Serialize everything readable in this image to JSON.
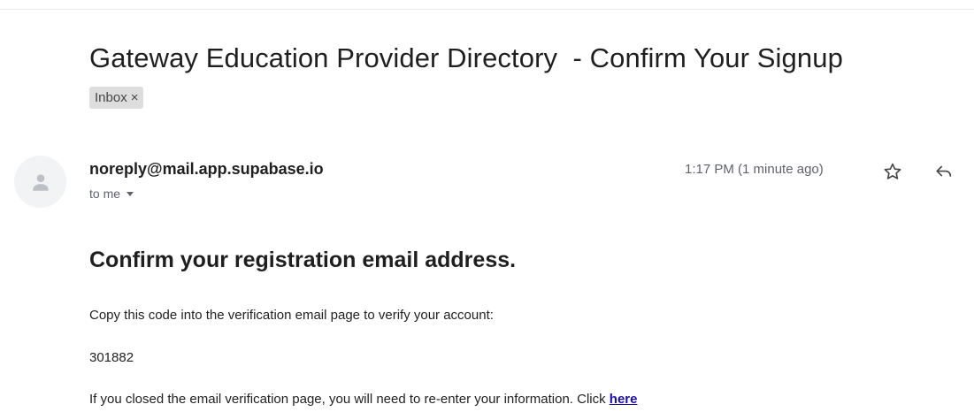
{
  "email": {
    "subject": "Gateway Education Provider Directory  - Confirm Your Signup",
    "label": "Inbox",
    "label_close": "×",
    "sender": "noreply@mail.app.supabase.io",
    "recipient": "to me",
    "time": "1:17 PM (1 minute ago)"
  },
  "body": {
    "heading": "Confirm your registration email address.",
    "instruction": "Copy this code into the verification email page to verify your account:",
    "code": "301882",
    "closed_text": "If you closed the email verification page, you will need to re-enter your information. Click ",
    "link_text": "here"
  },
  "icons": {
    "avatar": "person-icon",
    "star": "star-icon",
    "reply": "reply-icon",
    "caret": "chevron-down-icon",
    "chip_close": "close-icon"
  },
  "colors": {
    "link": "#1a0dab",
    "chip_bg": "#dddddd",
    "avatar_bg": "#f1f3f4",
    "muted_text": "#5f6368"
  }
}
